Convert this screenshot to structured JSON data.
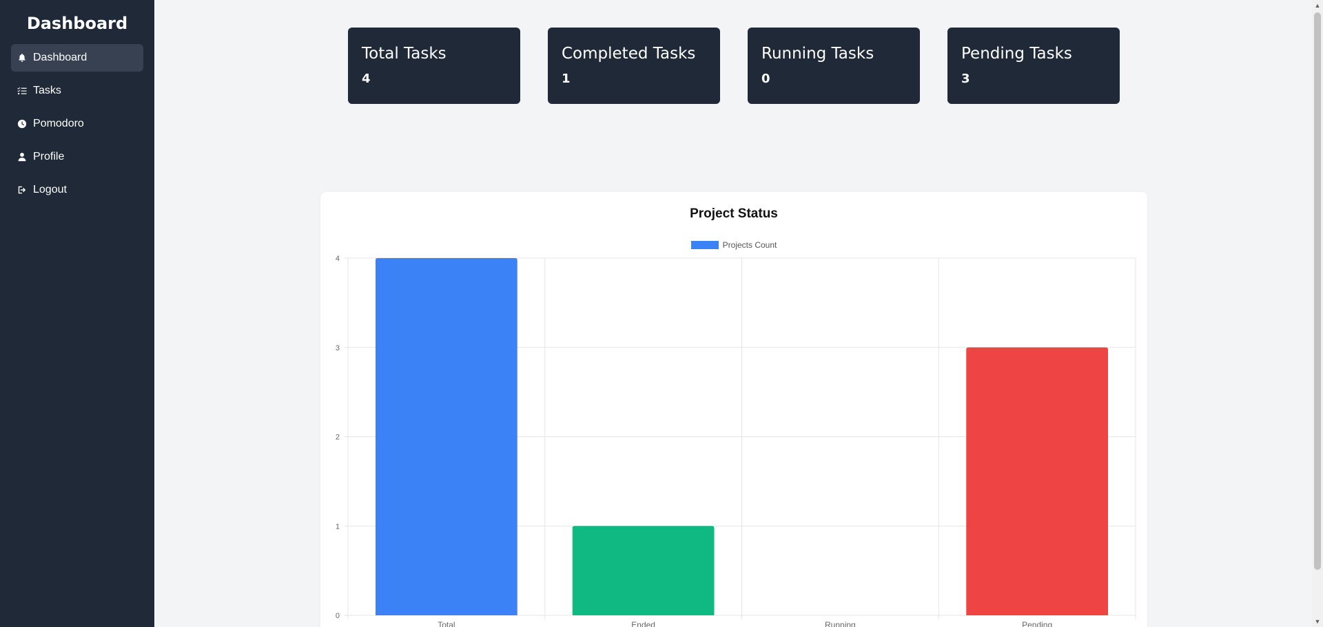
{
  "sidebar": {
    "title": "Dashboard",
    "items": [
      {
        "label": "Dashboard",
        "icon": "bell-icon",
        "active": true
      },
      {
        "label": "Tasks",
        "icon": "list-check-icon",
        "active": false
      },
      {
        "label": "Pomodoro",
        "icon": "clock-icon",
        "active": false
      },
      {
        "label": "Profile",
        "icon": "user-icon",
        "active": false
      },
      {
        "label": "Logout",
        "icon": "logout-icon",
        "active": false
      }
    ]
  },
  "stats": [
    {
      "title": "Total Tasks",
      "value": "4"
    },
    {
      "title": "Completed Tasks",
      "value": "1"
    },
    {
      "title": "Running Tasks",
      "value": "0"
    },
    {
      "title": "Pending Tasks",
      "value": "3"
    }
  ],
  "chart_data": {
    "type": "bar",
    "title": "Project Status",
    "categories": [
      "Total",
      "Ended",
      "Running",
      "Pending"
    ],
    "series": [
      {
        "name": "Projects Count",
        "values": [
          4,
          1,
          0,
          3
        ],
        "colors": [
          "#3b82f6",
          "#10b981",
          "#f59e0b",
          "#ef4444"
        ]
      }
    ],
    "legend_color": "#3b82f6",
    "ylim": [
      0,
      4
    ],
    "yticks": [
      0,
      1,
      2,
      3,
      4
    ],
    "grid": true,
    "legend_position": "top"
  },
  "colors": {
    "sidebar_bg": "#1f2937",
    "active_item_bg": "#374151",
    "page_bg": "#f3f4f6",
    "card_bg": "#1f2937"
  }
}
